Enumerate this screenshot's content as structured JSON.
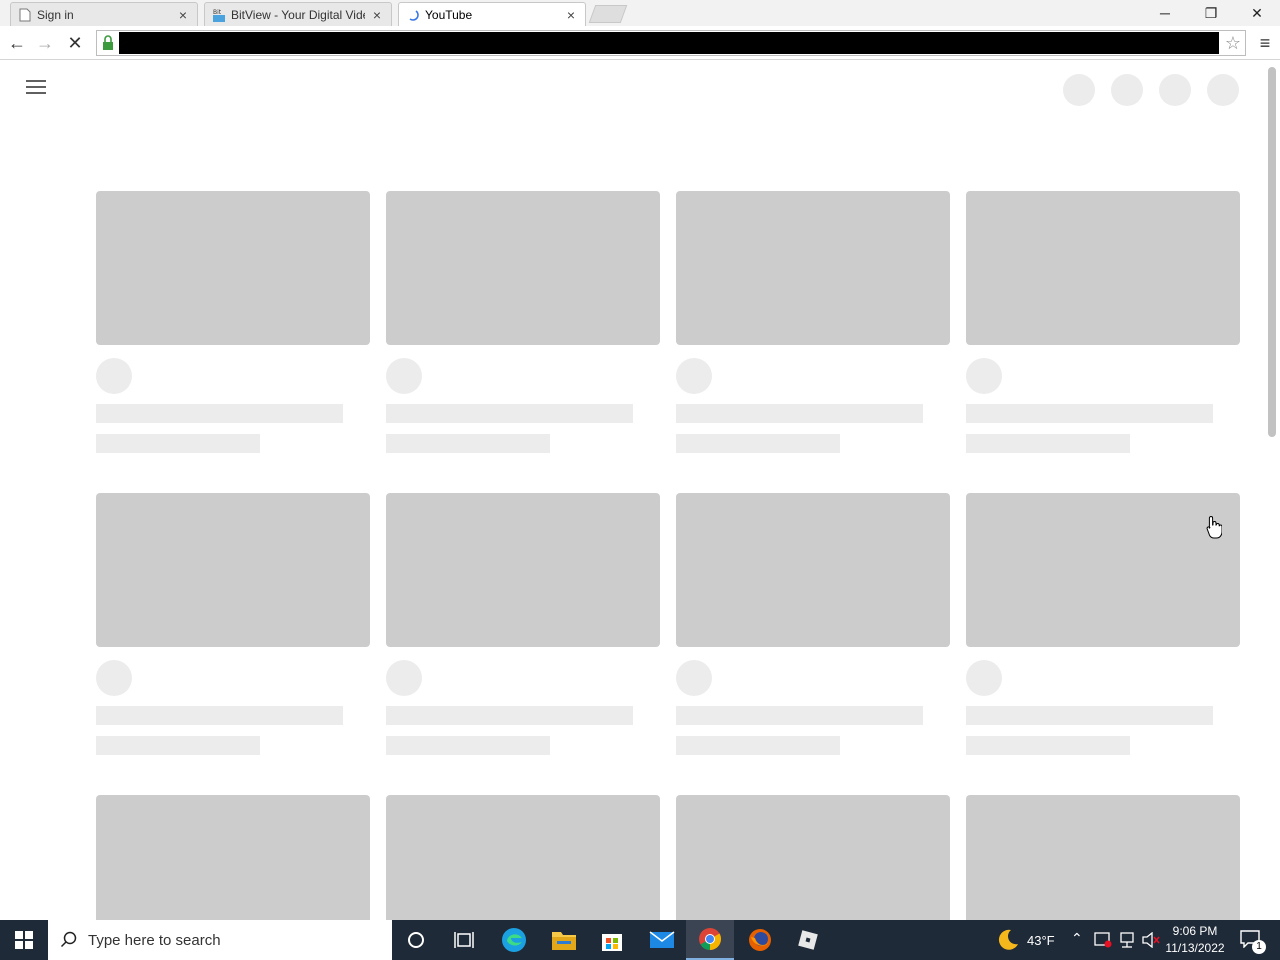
{
  "tabs": [
    {
      "title": "Sign in",
      "close": "×",
      "active": false
    },
    {
      "title": "BitView - Your Digital Vide",
      "close": "×",
      "active": false
    },
    {
      "title": "YouTube",
      "close": "×",
      "active": true
    }
  ],
  "window_controls": {
    "minimize": "─",
    "restore": "❐",
    "close": "✕"
  },
  "toolbar": {
    "back": "←",
    "forward": "→",
    "stop": "✕",
    "url": "",
    "star": "☆",
    "menu": "≡"
  },
  "taskbar": {
    "search_placeholder": "Type here to search",
    "weather": "43°F",
    "time": "9:06 PM",
    "date": "11/13/2022",
    "notification_count": "1"
  },
  "colors": {
    "skeleton_thumb": "#cccccc",
    "skeleton_text": "#ececec",
    "taskbar": "#1f2a38"
  },
  "icons": {
    "start": "windows-logo-icon",
    "task_view": "task-view-icon",
    "cortana": "cortana-icon",
    "edge": "edge-icon",
    "explorer": "file-explorer-icon",
    "store": "store-icon",
    "mail": "mail-icon",
    "chrome": "chrome-icon",
    "firefox": "firefox-icon",
    "roblox": "roblox-icon"
  }
}
